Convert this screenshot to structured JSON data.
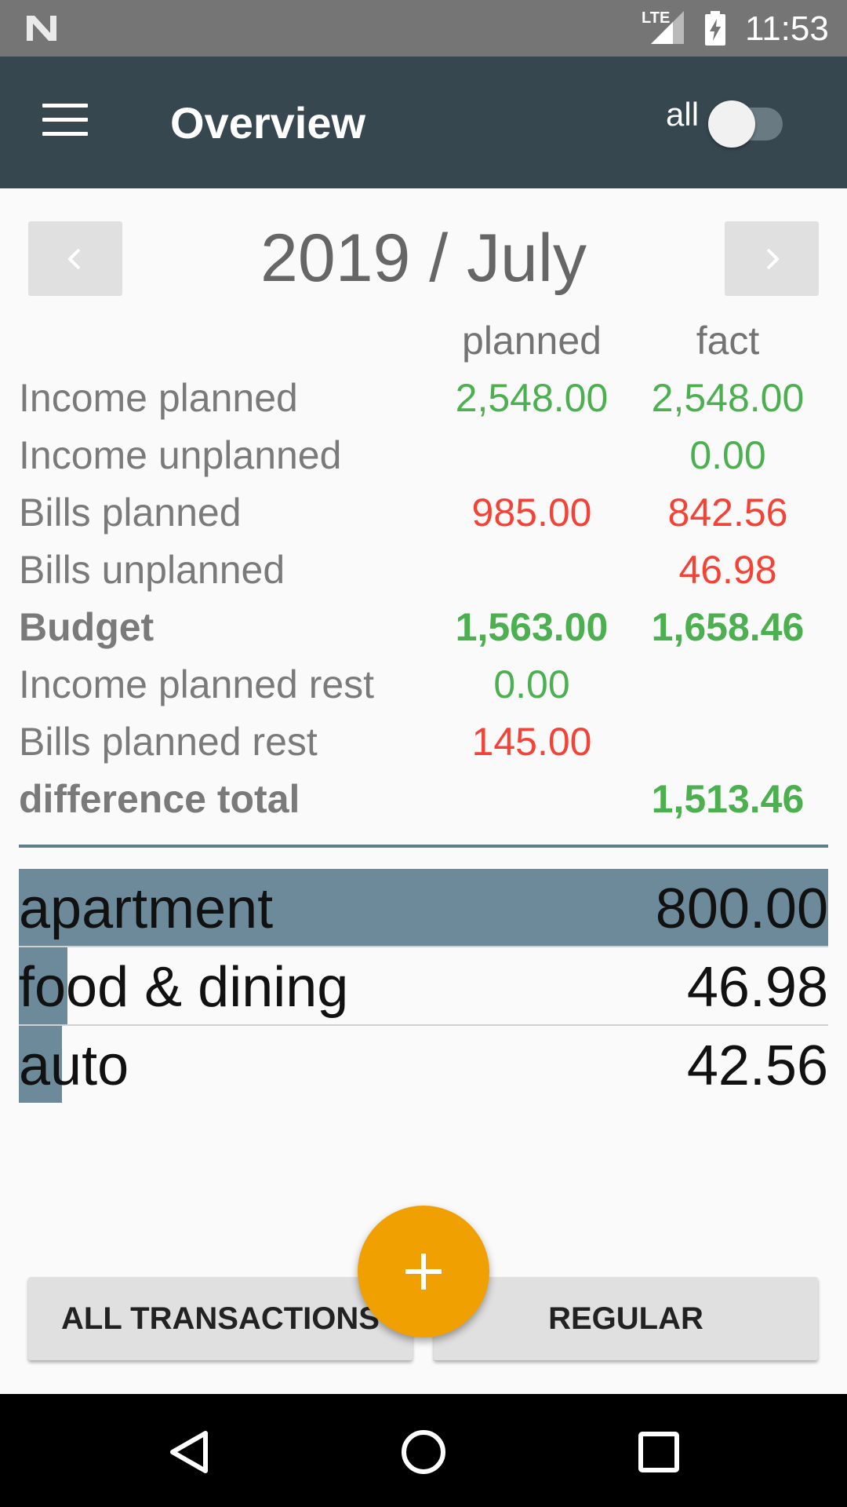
{
  "status_bar": {
    "time": "11:53",
    "network": "LTE",
    "icons": [
      "n-logo-icon",
      "signal-icon",
      "battery-charging-icon"
    ]
  },
  "app_bar": {
    "title": "Overview",
    "toggle_label": "all",
    "toggle_on": false,
    "menu_icon": "hamburger-menu-icon"
  },
  "period": {
    "title": "2019 / July",
    "prev_icon": "chevron-left-icon",
    "next_icon": "chevron-right-icon"
  },
  "summary": {
    "columns": {
      "planned": "planned",
      "fact": "fact"
    },
    "rows": [
      {
        "label": "Income planned",
        "planned": "2,548.00",
        "fact": "2,548.00"
      },
      {
        "label": "Income unplanned",
        "planned": "",
        "fact": "0.00"
      },
      {
        "label": "Bills planned",
        "planned": "985.00",
        "fact": "842.56"
      },
      {
        "label": "Bills unplanned",
        "planned": "",
        "fact": "46.98"
      },
      {
        "label": "Budget",
        "planned": "1,563.00",
        "fact": "1,658.46"
      },
      {
        "label": "Income planned rest",
        "planned": "0.00",
        "fact": ""
      },
      {
        "label": "Bills planned rest",
        "planned": "145.00",
        "fact": ""
      },
      {
        "label": "difference total",
        "planned": "",
        "fact": "1,513.46"
      }
    ]
  },
  "categories": [
    {
      "name": "apartment",
      "amount": "800.00",
      "share": 1.0
    },
    {
      "name": "food & dining",
      "amount": "46.98",
      "share": 0.06
    },
    {
      "name": "auto",
      "amount": "42.56",
      "share": 0.053
    }
  ],
  "buttons": {
    "all_transactions": "ALL TRANSACTIONS",
    "regular": "REGULAR",
    "fab_icon": "plus-icon"
  },
  "colors": {
    "app_bar": "#37474f",
    "income": "#4caf50",
    "bills": "#f44336",
    "fab": "#f0a000",
    "category_bar": "#6d8a9a"
  }
}
